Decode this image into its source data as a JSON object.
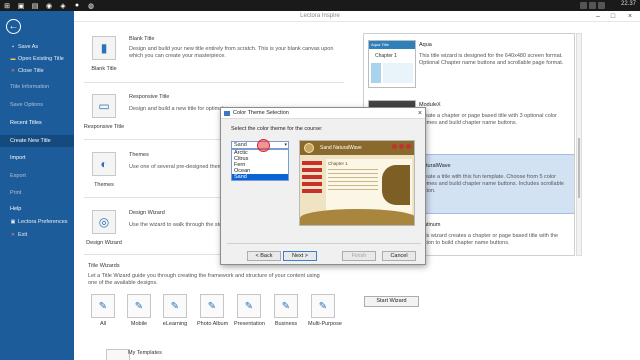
{
  "taskbar": {
    "clock": "22.37"
  },
  "window": {
    "title": "Lectora Inspire"
  },
  "sidebar": {
    "items": [
      {
        "label": "Save As",
        "icon": "save-icon"
      },
      {
        "label": "Open Existing Title",
        "icon": "folder-open-icon"
      },
      {
        "label": "Close Title",
        "icon": "close-icon"
      },
      {
        "label": "Title Information"
      },
      {
        "label": "Save Options"
      },
      {
        "label": "Recent Titles"
      },
      {
        "label": "Create New Title"
      },
      {
        "label": "Import"
      },
      {
        "label": "Export"
      },
      {
        "label": "Print"
      },
      {
        "label": "Help"
      },
      {
        "label": "Lectora Preferences",
        "icon": "preferences-icon"
      },
      {
        "label": "Exit",
        "icon": "exit-icon"
      }
    ]
  },
  "templates": [
    {
      "name": "Blank Title",
      "title": "Blank Title",
      "desc": "Design and build your new title entirely from scratch.  This is your blank canvas upon which you can create your masterpiece."
    },
    {
      "name": "Responsive Title",
      "title": "Responsive Title",
      "desc": "Design and build a new title for optimal"
    },
    {
      "name": "Themes",
      "title": "Themes",
      "desc": "Use one of several pre-designed themes"
    },
    {
      "name": "Design Wizard",
      "title": "Design Wizard",
      "desc": "Use the wizard to walk through the step"
    }
  ],
  "title_wizards": {
    "heading": "Title Wizards",
    "desc": "Let a Title Wizard guide you through creating the framework and structure of your content using one of the available designs.",
    "items": [
      "All",
      "Mobile",
      "eLearning",
      "Photo Album",
      "Presentation",
      "Business",
      "Multi-Purpose"
    ]
  },
  "my_templates": "My Templates",
  "previews": [
    {
      "name": "Aqua",
      "thumb_text": "Chapter 1",
      "thumb_header": "Aqua Title",
      "desc": "This title wizard is designed for the 640x480 screen format. Optional Chapter name buttons and scrollable page format."
    },
    {
      "name": "ModuleX",
      "desc": "Create a chapter or page based title with 3 optional color themes and build chapter name buttons."
    },
    {
      "name": "NaturalWave",
      "desc": "Create a title with this fun template. Choose from 5 color themes and build chapter name buttons. Includes scrollable option."
    },
    {
      "name": "Platinum",
      "desc": "This wizard creates a chapter or page based title with the option to build chapter name buttons."
    }
  ],
  "start_wizard": "Start Wizard",
  "dialog": {
    "title": "Color Theme Selection",
    "prompt": "Select the color theme for the course:",
    "selected": "Sand",
    "options": [
      "Arctic",
      "Citrus",
      "Fern",
      "Ocean",
      "Sand"
    ],
    "preview_title": "Sand NaturalWave",
    "preview_chapter": "Chapter 1",
    "buttons": {
      "back": "< Back",
      "next": "Next >",
      "finish": "Finish",
      "cancel": "Cancel"
    }
  },
  "colors": {
    "sidebar": "#1d5c9a",
    "accent": "#0b63d6",
    "selected_row": "#d3e2f3"
  }
}
